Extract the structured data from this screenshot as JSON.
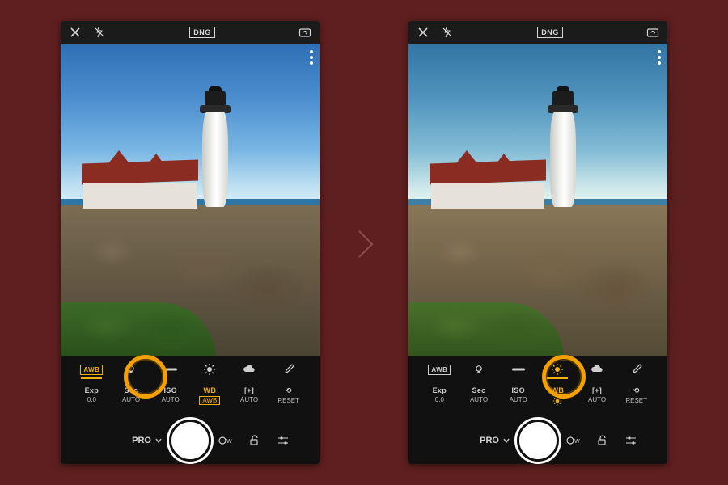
{
  "topbar": {
    "format": "DNG"
  },
  "mode": {
    "label": "PRO"
  },
  "wb_presets": [
    {
      "id": "awb",
      "label": "AWB"
    },
    {
      "id": "incandescent",
      "label": ""
    },
    {
      "id": "fluorescent",
      "label": ""
    },
    {
      "id": "daylight",
      "label": ""
    },
    {
      "id": "cloudy",
      "label": ""
    },
    {
      "id": "eyedropper",
      "label": ""
    }
  ],
  "params": [
    {
      "id": "exp",
      "label": "Exp",
      "value": "0.0"
    },
    {
      "id": "sec",
      "label": "Sec",
      "value": "AUTO"
    },
    {
      "id": "iso",
      "label": "ISO",
      "value": "AUTO"
    },
    {
      "id": "wb",
      "label": "WB",
      "value": "AWB"
    },
    {
      "id": "bracket",
      "label": "[+]",
      "value": "AUTO"
    },
    {
      "id": "reset",
      "label": "↺",
      "value": "RESET"
    }
  ],
  "left": {
    "active_preset": "awb",
    "active_param": "wb"
  },
  "right": {
    "active_preset": "daylight",
    "active_param": "wb",
    "wb_value_icon": "daylight"
  }
}
